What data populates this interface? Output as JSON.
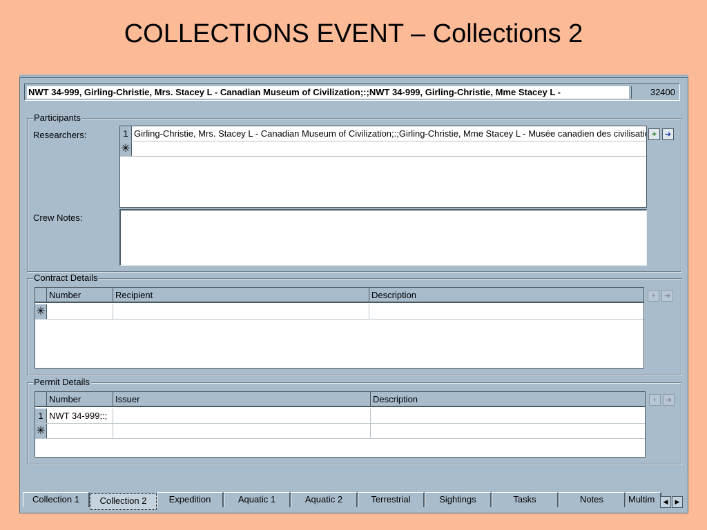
{
  "slide": {
    "title": "COLLECTIONS EVENT – Collections 2"
  },
  "header": {
    "record_text": "NWT 34-999, Girling-Christie, Mrs. Stacey L - Canadian Museum of Civilization;:;NWT 34-999, Girling-Christie, Mme Stacey L -",
    "record_number": "32400"
  },
  "participants": {
    "group_label": "Participants",
    "researchers_label": "Researchers:",
    "researchers": [
      {
        "row": "1",
        "value": "Girling-Christie, Mrs. Stacey L - Canadian Museum of Civilization;:;Girling-Christie, Mme Stacey L - Musée canadien des civilisations"
      }
    ],
    "new_row_marker": "✳",
    "crew_notes_label": "Crew Notes:",
    "crew_notes_value": ""
  },
  "contract_details": {
    "group_label": "Contract Details",
    "columns": [
      "Number",
      "Recipient",
      "Description"
    ],
    "new_row_marker": "✳"
  },
  "permit_details": {
    "group_label": "Permit Details",
    "columns": [
      "Number",
      "Issuer",
      "Description"
    ],
    "rows": [
      {
        "row": "1",
        "number": "NWT 34-999;:;",
        "issuer": "",
        "description": ""
      }
    ],
    "new_row_marker": "✳"
  },
  "tabs": [
    {
      "label": "Collection 1",
      "active": false
    },
    {
      "label": "Collection 2",
      "active": true
    },
    {
      "label": "Expedition",
      "active": false
    },
    {
      "label": "Aquatic 1",
      "active": false
    },
    {
      "label": "Aquatic 2",
      "active": false
    },
    {
      "label": "Terrestrial",
      "active": false
    },
    {
      "label": "Sightings",
      "active": false
    },
    {
      "label": "Tasks",
      "active": false
    },
    {
      "label": "Notes",
      "active": false
    },
    {
      "label": "Multim",
      "active": false
    }
  ],
  "icons": {
    "add": "add-record-icon",
    "goto": "goto-record-icon",
    "scroll_left": "scroll-left-icon",
    "scroll_right": "scroll-right-icon"
  },
  "colors": {
    "slide_background": "#fcba97",
    "window_background": "#a9bccc"
  }
}
